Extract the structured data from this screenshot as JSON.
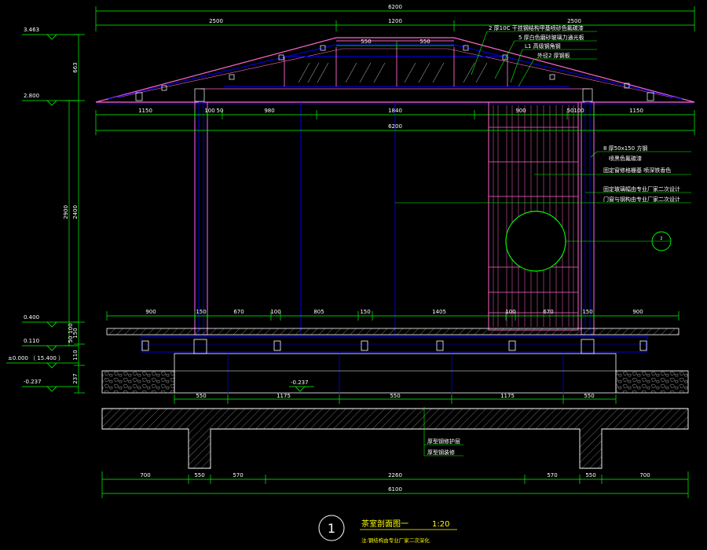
{
  "colors": {
    "background": "#000000",
    "dimension": "#00ff00",
    "structure": "#0000ff",
    "roof": "#ff66cc",
    "wall": "#ff66ff",
    "text": "#ffffff",
    "title": "#ffff00"
  },
  "dimensions": {
    "top_total": "6200",
    "top_left": "2500",
    "top_mid": "1200",
    "top_right": "2500",
    "ridge_left": "550",
    "ridge_right": "550",
    "eave_row": [
      "1150",
      "100",
      "50",
      "980",
      "1840",
      "900",
      "50",
      "100",
      "1150"
    ],
    "eave_total": "6200",
    "deck_row": [
      "900",
      "150",
      "670",
      "100",
      "805",
      "150",
      "1405",
      "100",
      "670",
      "150",
      "900"
    ],
    "footing_row": [
      "550",
      "1175",
      "550",
      "1175",
      "550"
    ],
    "bottom_row": [
      "700",
      "550",
      "570",
      "2260",
      "570",
      "550",
      "700"
    ],
    "bottom_total": "6100",
    "left_vertical": [
      "663",
      "2400",
      "150",
      "110",
      "237"
    ],
    "left_vertical_overall": "2900",
    "left_small": [
      "100",
      "50"
    ]
  },
  "levels": [
    {
      "value": "3.463"
    },
    {
      "value": "2.800"
    },
    {
      "value": "0.400"
    },
    {
      "value": "0.110"
    },
    {
      "value": "±0.000 （ 15.400 ）"
    },
    {
      "value": "-0.237"
    }
  ],
  "mid_level": "-0.237",
  "annotations": {
    "roof_1": "2 厚10C 干挂钢结构甲基喷砂色氟碳漆",
    "roof_2": "5 厚白色磨砂玻璃力通光板",
    "roof_3": "L1 高级钢角钢",
    "roof_4": "外径2 厚钢板",
    "wall_1": "8 厚50x150  方钢",
    "wall_2": "喷黑色氟碳漆",
    "wall_3": "固定窗修格栅基 喷深铁香色",
    "wall_4": "固定玻璃幅由专业厂家二次设计",
    "wall_5": "门窗与钢构由专业厂家二次设计",
    "footing_1": "厚型钢修护层",
    "footing_2": "厚型钢装修"
  },
  "section_marker": {
    "number": "2"
  },
  "title_block": {
    "number": "1",
    "title": "茶室剖面图一",
    "scale": "1:20",
    "note": "注:钢结构由专业厂家二次深化"
  }
}
